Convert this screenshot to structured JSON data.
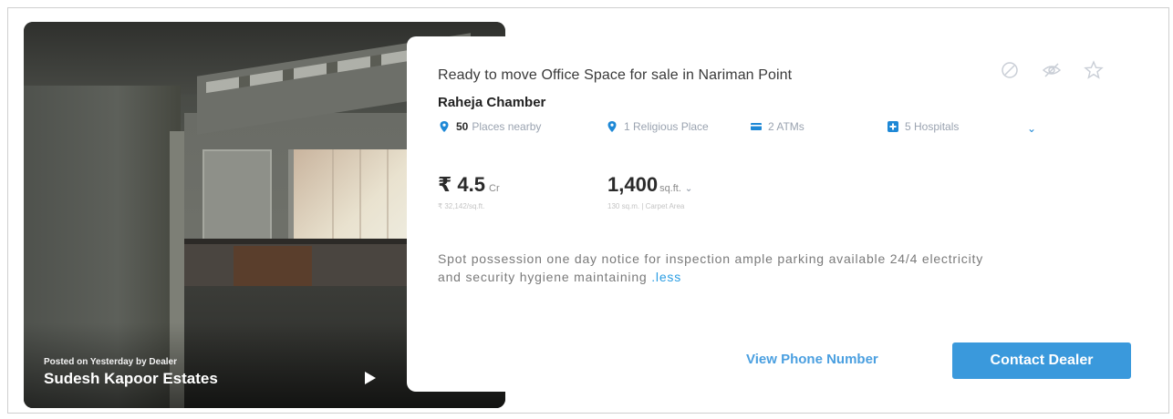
{
  "listing": {
    "posted_text": "Posted on Yesterday by Dealer",
    "dealer_name": "Sudesh Kapoor Estates",
    "title": "Ready to move Office Space for sale in Nariman Point",
    "project_name": "Raheja Chamber",
    "top_icons": [
      "block-icon",
      "hide-icon",
      "star-icon"
    ],
    "amenities": {
      "nearby_count": "50",
      "nearby_label": "Places nearby",
      "items": [
        {
          "label": "1 Religious Place",
          "icon": "location-pin-icon"
        },
        {
          "label": "2 ATMs",
          "icon": "atm-card-icon"
        },
        {
          "label": "5 Hospitals",
          "icon": "hospital-icon"
        }
      ]
    },
    "price": {
      "value": "₹ 4.5",
      "unit": "Cr",
      "sub": "₹ 32,142/sq.ft."
    },
    "area": {
      "value": "1,400",
      "unit": "sq.ft.",
      "sub": "130 sq.m. | Carpet Area"
    },
    "description": "Spot possession one day notice for inspection ample parking available 24/4 electricity and security hygiene maintaining",
    "less_link": ".less",
    "actions": {
      "view_phone": "View Phone Number",
      "contact": "Contact Dealer"
    }
  },
  "colors": {
    "accent": "#3a99dc",
    "link": "#2a9de3",
    "icon_blue": "#1e88d6"
  }
}
